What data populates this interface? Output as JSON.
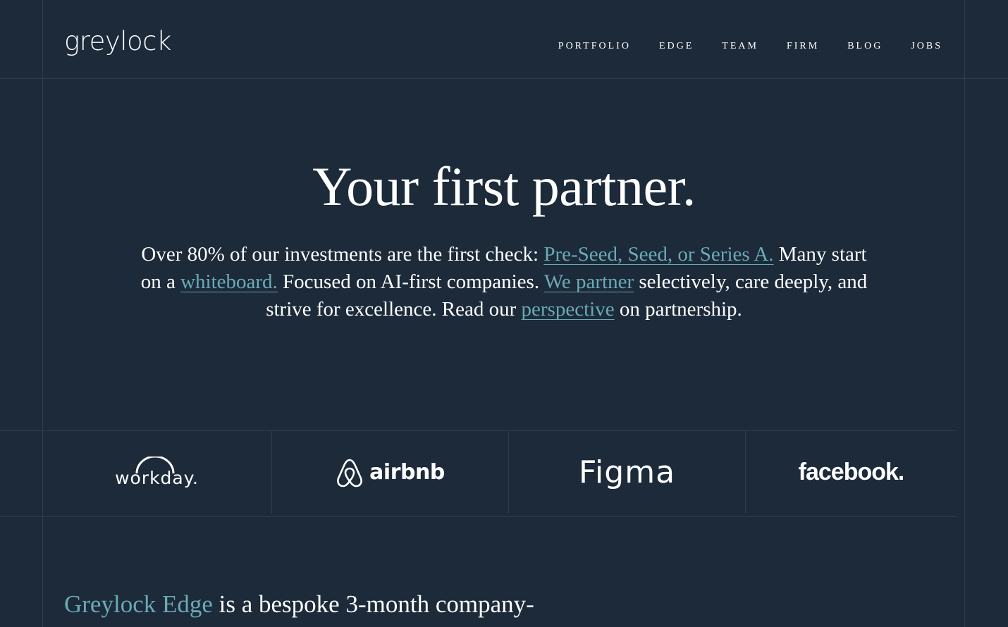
{
  "header": {
    "logo": "greylock",
    "nav": [
      "PORTFOLIO",
      "EDGE",
      "TEAM",
      "FIRM",
      "BLOG",
      "JOBS"
    ]
  },
  "hero": {
    "title": "Your first partner.",
    "p1": "Over 80% of our investments are the first check: ",
    "link1": "Pre-Seed, Seed, or Series A.",
    "p2": " Many start on a ",
    "link2": "whiteboard.",
    "p3": " Focused on AI-first companies. ",
    "link3": "We partner",
    "p4": " selectively, care deeply, and strive for excellence. Read our ",
    "link4": "perspective",
    "p5": " on partnership."
  },
  "logos": [
    "workday.",
    "airbnb",
    "Figma",
    "facebook."
  ],
  "edge": {
    "link": "Greylock Edge",
    "text": " is a bespoke 3-month company-"
  },
  "colors": {
    "background": "#1c2a3a",
    "accent": "#6aaab5",
    "line": "#2e3e50"
  }
}
